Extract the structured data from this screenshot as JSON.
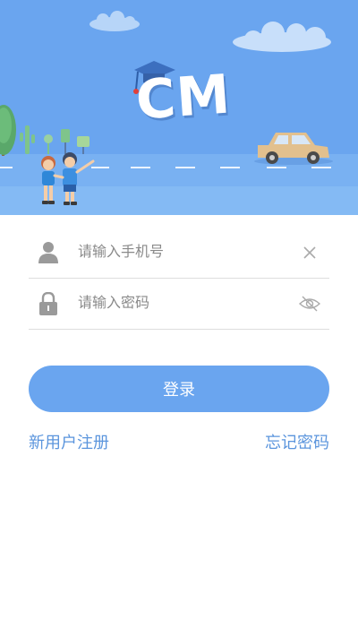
{
  "banner": {
    "logo_text": "CM",
    "background_color": "#6aa5ef"
  },
  "login_form": {
    "phone_field": {
      "placeholder": "请输入手机号",
      "value": "",
      "leading_icon": "user-icon",
      "trailing_icon": "clear-icon"
    },
    "password_field": {
      "placeholder": "请输入密码",
      "value": "",
      "leading_icon": "lock-icon",
      "trailing_icon": "eye-hidden-icon"
    },
    "login_button_label": "登录",
    "register_link": "新用户注册",
    "forgot_password_link": "忘记密码"
  },
  "colors": {
    "accent": "#6aa5ef",
    "link": "#5b95dd"
  }
}
